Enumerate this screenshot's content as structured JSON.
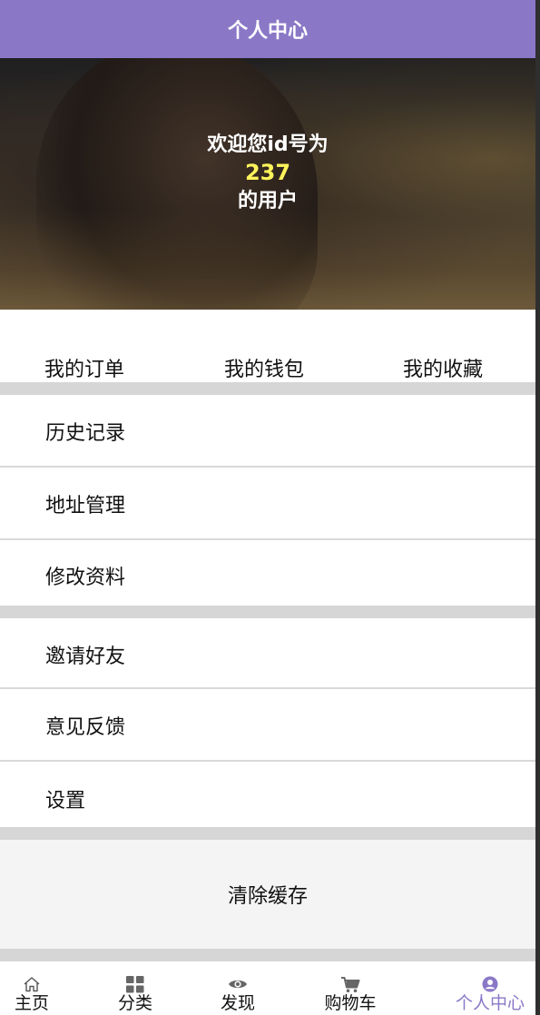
{
  "header": {
    "title": "个人中心"
  },
  "hero": {
    "welcome_line1": "欢迎您id号为",
    "user_id": "237",
    "welcome_line2": "的用户"
  },
  "quick_links": [
    {
      "label": "我的订单"
    },
    {
      "label": "我的钱包"
    },
    {
      "label": "我的收藏"
    }
  ],
  "menu_group_1": [
    {
      "label": "历史记录"
    },
    {
      "label": "地址管理"
    },
    {
      "label": "修改资料"
    }
  ],
  "menu_group_2": [
    {
      "label": "邀请好友"
    },
    {
      "label": "意见反馈"
    },
    {
      "label": "设置"
    }
  ],
  "clear_cache": {
    "label": "清除缓存"
  },
  "tabbar": {
    "items": [
      {
        "label": "主页",
        "icon": "home-icon"
      },
      {
        "label": "分类",
        "icon": "grid-icon"
      },
      {
        "label": "发现",
        "icon": "eye-icon"
      },
      {
        "label": "购物车",
        "icon": "cart-icon"
      },
      {
        "label": "个人中心",
        "icon": "user-icon",
        "active": true
      }
    ]
  },
  "colors": {
    "accent": "#8a78c7",
    "user_id": "#fff45a",
    "separator": "#d6d6d6"
  }
}
